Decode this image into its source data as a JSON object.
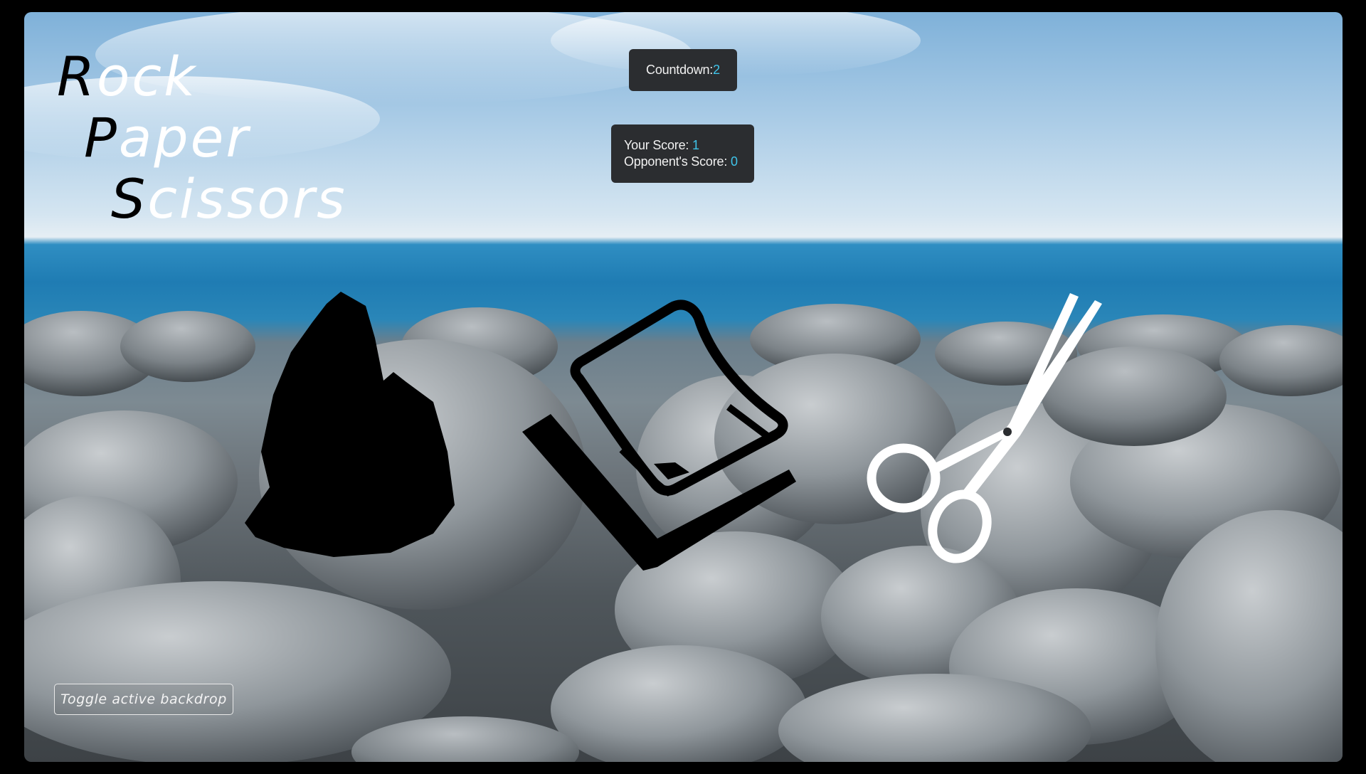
{
  "title": {
    "line1_cap": "R",
    "line1_rest": "ock",
    "line2_cap": "P",
    "line2_rest": "aper",
    "line3_cap": "S",
    "line3_rest": "cissors"
  },
  "countdown": {
    "label": "Countdown: ",
    "value": "2"
  },
  "score": {
    "you_label": "Your Score: ",
    "you_value": "1",
    "opp_label": "Opponent's Score: ",
    "opp_value": "0"
  },
  "choices": [
    {
      "name": "rock",
      "icon": "rock-icon"
    },
    {
      "name": "paper",
      "icon": "paper-icon"
    },
    {
      "name": "scissors",
      "icon": "scissors-icon"
    }
  ],
  "toggle_backdrop_label": "Toggle active backdrop",
  "colors": {
    "accent": "#3fc4ea",
    "panel": "#2b2d30",
    "icon_dark": "#000000",
    "icon_light": "#ffffff"
  }
}
